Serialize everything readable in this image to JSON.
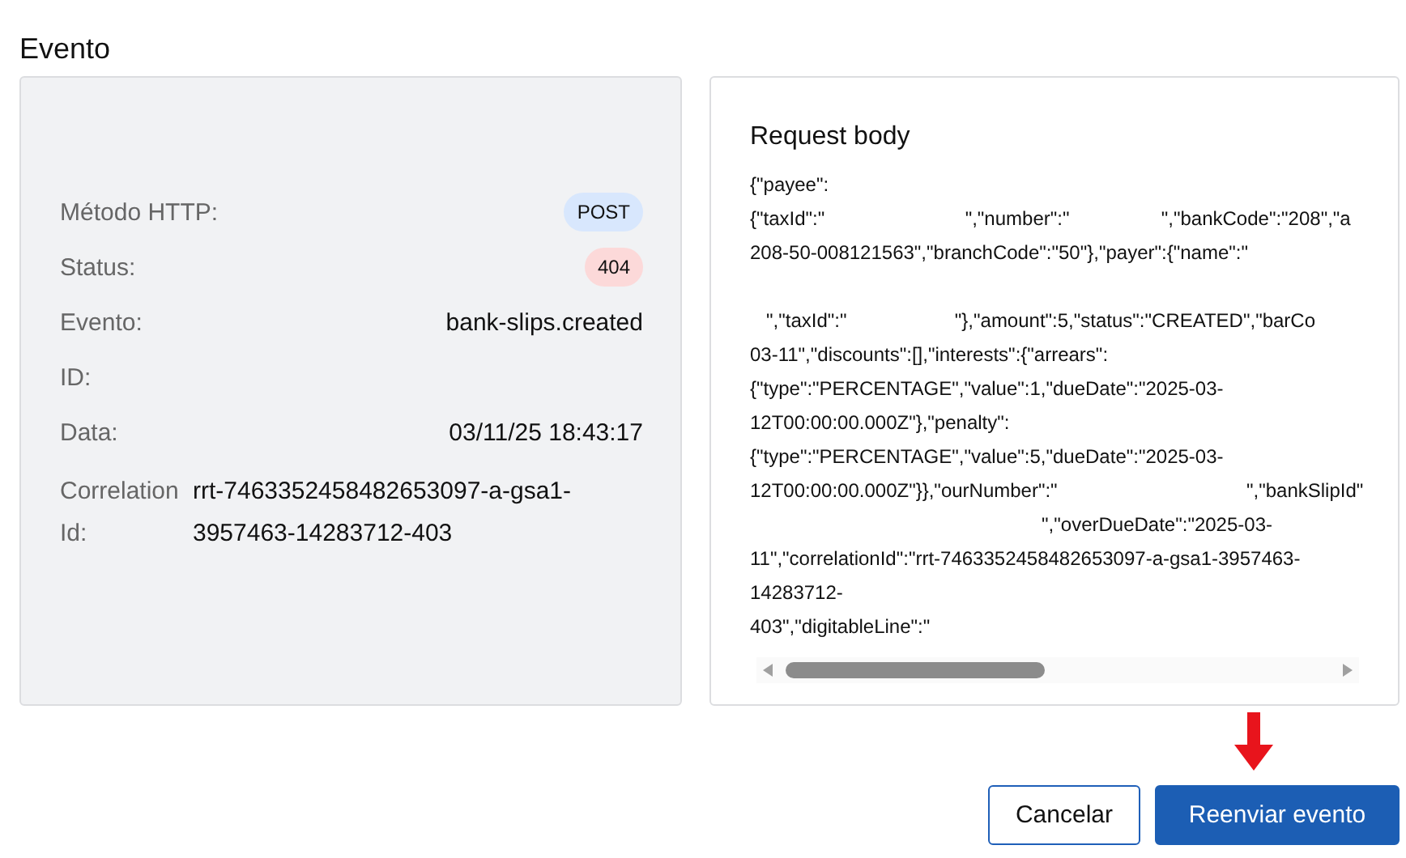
{
  "title": "Evento",
  "details": [
    {
      "label": "Método HTTP:",
      "value": "POST",
      "kind": "badge",
      "color": "#d8e7fd"
    },
    {
      "label": "Status:",
      "value": "404",
      "kind": "badge",
      "color": "#fcd9d9"
    },
    {
      "label": "Evento:",
      "value": "bank-slips.created",
      "kind": "text"
    },
    {
      "label": "ID:",
      "kind": "text"
    },
    {
      "label": "Data:",
      "value": "03/11/25 18:43:17",
      "kind": "text"
    },
    {
      "label": "Correlation Id:",
      "value": "rrt-7463352458482653097-a-gsa1-3957463-14283712-403",
      "kind": "wrap"
    }
  ],
  "request": {
    "title": "Request body",
    "lines": [
      {
        "text": "{\"payee\":"
      },
      {
        "text": "{\"taxId\":\"                          \",\"number\":\"                 \",\"bankCode\":\"208\",\"a"
      },
      {
        "text": "208-50-008121563\",\"branchCode\":\"50\"},\"payer\":{\"name\":\""
      },
      {
        "text": "   \",\"taxId\":\"                    \"},\"amount\":5,\"status\":\"CREATED\",\"barCo",
        "gap_before": true
      },
      {
        "text": "03-11\",\"discounts\":[],\"interests\":{\"arrears\":"
      },
      {
        "text": "{\"type\":\"PERCENTAGE\",\"value\":1,\"dueDate\":\"2025-03-"
      },
      {
        "text": "12T00:00:00.000Z\"},\"penalty\":"
      },
      {
        "text": "{\"type\":\"PERCENTAGE\",\"value\":5,\"dueDate\":\"2025-03-"
      },
      {
        "text": "12T00:00:00.000Z\"}},\"ourNumber\":\"                                   \",\"bankSlipId\""
      },
      {
        "text": "                                                      \",\"overDueDate\":\"2025-03-"
      },
      {
        "text": "11\",\"correlationId\":\"rrt-7463352458482653097-a-gsa1-3957463-"
      },
      {
        "text": "14283712-"
      },
      {
        "text": "403\",\"digitableLine\":\""
      }
    ]
  },
  "buttons": [
    {
      "label": "Cancelar",
      "kind": "secondary"
    },
    {
      "label": "Reenviar evento",
      "kind": "primary"
    }
  ]
}
